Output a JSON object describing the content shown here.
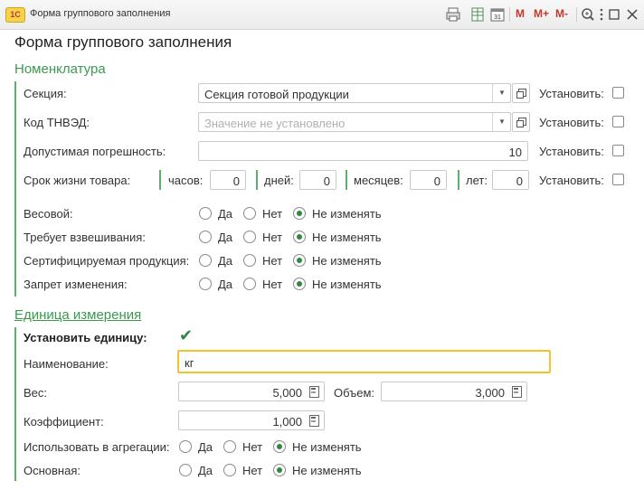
{
  "window": {
    "title": "Форма группового заполнения",
    "logo_text": "1С",
    "m_label": "M",
    "m_plus_label": "M+",
    "m_minus_label": "M-"
  },
  "form": {
    "title": "Форма группового заполнения"
  },
  "nomenclature": {
    "title": "Номенклатура",
    "set_label": "Установить:",
    "section": {
      "label": "Секция:",
      "value": "Секция готовой продукции"
    },
    "tnved": {
      "label": "Код ТНВЭД:",
      "placeholder": "Значение не установлено"
    },
    "tolerance": {
      "label": "Допустимая погрешность:",
      "value": "10"
    },
    "shelf_life": {
      "label": "Срок жизни товара:",
      "hours_label": "часов:",
      "hours": "0",
      "days_label": "дней:",
      "days": "0",
      "months_label": "месяцев:",
      "months": "0",
      "years_label": "лет:",
      "years": "0"
    },
    "radio_options": {
      "yes": "Да",
      "no": "Нет",
      "keep": "Не изменять"
    },
    "radio_rows": [
      {
        "label": "Весовой:",
        "selected": "keep"
      },
      {
        "label": "Требует взвешивания:",
        "selected": "keep"
      },
      {
        "label": "Сертифицируемая продукция:",
        "selected": "keep"
      },
      {
        "label": "Запрет изменения:",
        "selected": "keep"
      }
    ]
  },
  "unit": {
    "title": "Единица измерения",
    "set_unit_label": "Установить единицу:",
    "set_unit_checked": true,
    "name": {
      "label": "Наименование:",
      "value": "кг"
    },
    "weight": {
      "label": "Вес:",
      "value": "5,000"
    },
    "volume": {
      "label": "Объем:",
      "value": "3,000"
    },
    "coef": {
      "label": "Коэффициент:",
      "value": "1,000"
    },
    "radio_rows": [
      {
        "label": "Использовать в агрегации:",
        "selected": "keep"
      },
      {
        "label": "Основная:",
        "selected": "keep"
      }
    ]
  },
  "colors": {
    "accent": "#3a9a4d",
    "focus": "#f2c230",
    "title_red": "#c0392b"
  },
  "icons": [
    "print-icon",
    "table-icon",
    "calendar-icon",
    "zoom-icon",
    "more-icon",
    "maximize-icon",
    "close-icon"
  ]
}
